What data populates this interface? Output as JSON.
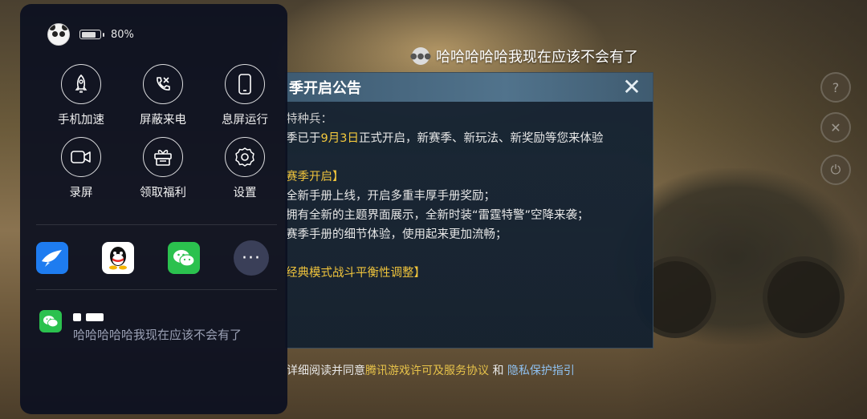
{
  "status": {
    "battery_label": "80%",
    "battery_level": 0.8
  },
  "tools": [
    {
      "label": "手机加速",
      "icon": "rocket-icon"
    },
    {
      "label": "屏蔽来电",
      "icon": "block-call-icon"
    },
    {
      "label": "息屏运行",
      "icon": "phone-screen-icon"
    },
    {
      "label": "录屏",
      "icon": "video-camera-icon"
    },
    {
      "label": "领取福利",
      "icon": "gift-icon"
    },
    {
      "label": "设置",
      "icon": "gear-icon"
    }
  ],
  "apps": [
    {
      "icon": "bird-app-icon",
      "color": "#1e7cf0"
    },
    {
      "icon": "qq-app-icon",
      "color": "#ffffff"
    },
    {
      "icon": "wechat-app-icon",
      "color": "#2bc14e"
    },
    {
      "icon": "more-icon",
      "label": "···"
    }
  ],
  "notification": {
    "icon": "wechat-icon",
    "text": "哈哈哈哈哈我现在应该不会有了"
  },
  "chat_bubble": {
    "text": "哈哈哈哈哈我现在应该不会有了",
    "icon": "chat-bubble-icon"
  },
  "notice": {
    "title": "季开启公告",
    "close": "✕",
    "greeting": "特种兵：",
    "line1_pre": "季已于",
    "line1_date": "9月3日",
    "line1_post": "正式开启，新赛季、新玩法、新奖励等您来体验",
    "section1": "赛季开启】",
    "item1": "全新手册上线，开启多重丰厚手册奖励；",
    "item2": "拥有全新的主题界面展示，全新时装“雷霆特警”空降来袭；",
    "item3": "赛季手册的细节体验，使用起来更加流畅；",
    "section2": "经典模式战斗平衡性调整】"
  },
  "agreement": {
    "pre": "详细阅读并同意",
    "link1": "腾讯游戏许可及服务协议",
    "and": "和",
    "link2": "隐私保护指引"
  },
  "colors": {
    "panel_bg": "#0c1020",
    "accent_yellow": "#f4c93d",
    "wechat_green": "#2bc14e"
  }
}
